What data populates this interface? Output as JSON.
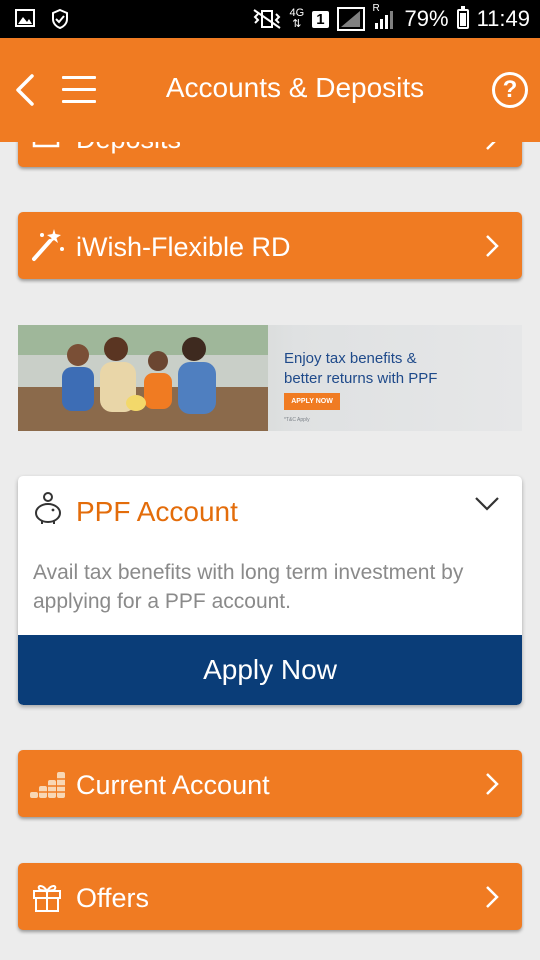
{
  "status_bar": {
    "network": "4G",
    "sim": "1",
    "roaming": "R",
    "battery": "79%",
    "time": "11:49"
  },
  "header": {
    "title": "Accounts & Deposits"
  },
  "menu_items": [
    {
      "label": "Deposits",
      "icon": "deposits-icon"
    },
    {
      "label": "iWish-Flexible RD",
      "icon": "magic-wand-icon"
    },
    {
      "label": "Current Account",
      "icon": "coins-stack-icon"
    },
    {
      "label": "Offers",
      "icon": "gift-icon"
    }
  ],
  "banner": {
    "line1": "Enjoy tax benefits &",
    "line2": "better returns with PPF",
    "cta": "APPLY NOW",
    "fine_print": "*T&C Apply"
  },
  "ppf_card": {
    "title": "PPF Account",
    "description": "Avail tax benefits with long term investment by applying for a PPF account.",
    "apply_label": "Apply Now"
  },
  "colors": {
    "brand_orange": "#f07b22",
    "apply_blue": "#0a3d78",
    "background": "#ececec"
  }
}
